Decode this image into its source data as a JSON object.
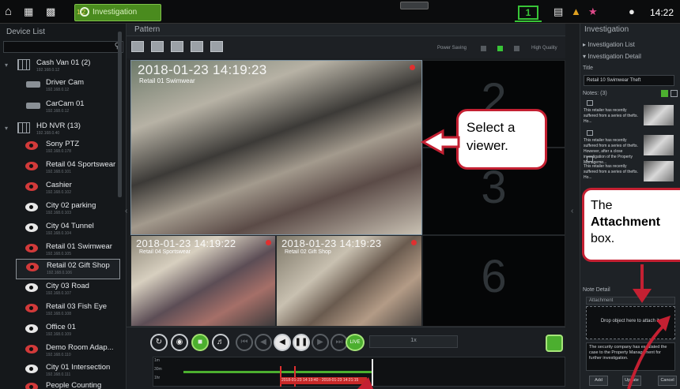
{
  "topbar": {
    "tab_label": "Investigation",
    "tab_prefix": "1/2",
    "screen_number": "1",
    "clock": "14:22"
  },
  "device_list": {
    "title": "Device List",
    "search_placeholder": "",
    "groups": [
      {
        "name": "Cash Van 01 (2)",
        "sub": "192.168.0.12",
        "items": [
          {
            "name": "Driver Cam",
            "sub": "192.168.0.12"
          },
          {
            "name": "CarCam 01",
            "sub": "192.168.0.12"
          }
        ]
      },
      {
        "name": "HD NVR (13)",
        "sub": "192.168.0.40",
        "items": [
          {
            "name": "Sony PTZ",
            "sub": "192.168.0.178"
          },
          {
            "name": "Retail 04 Sportswear",
            "sub": "192.168.0.101"
          },
          {
            "name": "Cashier",
            "sub": "192.168.0.102"
          },
          {
            "name": "City 02 parking",
            "sub": "192.168.0.103"
          },
          {
            "name": "City 04 Tunnel",
            "sub": "192.168.0.104"
          },
          {
            "name": "Retail 01 Swimwear",
            "sub": "192.168.0.105"
          },
          {
            "name": "Retail 02 Gift Shop",
            "sub": "192.168.0.106"
          },
          {
            "name": "City 03 Road",
            "sub": "192.168.0.107"
          },
          {
            "name": "Retail 03 Fish Eye",
            "sub": "192.168.0.108"
          },
          {
            "name": "Office 01",
            "sub": "192.168.0.109"
          },
          {
            "name": "Demo Room Adap...",
            "sub": "192.168.0.110"
          },
          {
            "name": "City 01 Intersection",
            "sub": "192.168.0.111"
          },
          {
            "name": "People Counting",
            "sub": "192.168.0.112"
          }
        ]
      }
    ]
  },
  "pattern": {
    "title": "Pattern",
    "power_saving": "Power Saving",
    "high_quality": "High Quality"
  },
  "viewers": {
    "big": {
      "timestamp": "2018-01-23  14:19:23",
      "camera": "Retail 01 Swimwear"
    },
    "small1": {
      "timestamp": "2018-01-23  14:19:22",
      "camera": "Retail 04 Sportswear"
    },
    "small2": {
      "timestamp": "2018-01-23  14:19:23",
      "camera": "Retail 02 Gift Shop"
    },
    "empty_numbers": [
      "2",
      "3",
      "6"
    ]
  },
  "callouts": {
    "select_line1": "Select a",
    "select_line2": "viewer.",
    "attach_line1": "The",
    "attach_line2": "Attachment",
    "attach_line3": "box."
  },
  "playback": {
    "live": "LIVE",
    "speed": "1x",
    "zoom_levels": [
      "1m",
      "30m",
      "1hr"
    ],
    "range_label": "2018-01-23 14:19:40 - 2018-01-23 14:21:15"
  },
  "investigation": {
    "title": "Investigation",
    "list_link": "Investigation List",
    "detail_link": "Investigation Detail",
    "title_label": "Title",
    "title_value": "Retail 10 Swimwear Theft",
    "notes_label": "Notes: (3)",
    "notes": [
      "This retailer has recently suffered from a series of thefts. Ho...",
      "This retailer has recently suffered from a series of thefts. However, after a close investigation of the Property Manageme...",
      "This retailer has recently suffered from a series of thefts. Ho..."
    ],
    "note_detail_label": "Note Detail",
    "attachment_label": "Attachment",
    "drop_text": "Drop object here to attach it.",
    "note_text": "The security company has escalated the case to the Property Management for further investigation.",
    "add_button": "Add",
    "update_button": "Update",
    "cancel_button": "Cancel"
  },
  "colors": {
    "accent_green": "#4caf2f",
    "callout_red": "#c42032"
  }
}
